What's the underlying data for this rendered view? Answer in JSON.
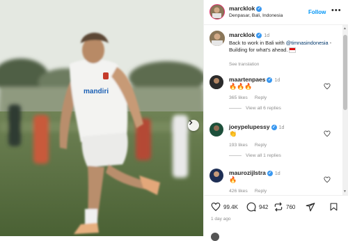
{
  "post": {
    "username": "marcklok",
    "location": "Denpasar, Bali, Indonesia",
    "follow_label": "Follow",
    "more_label": "•••",
    "verified_mark": "✓"
  },
  "caption": {
    "username": "marcklok",
    "time": "1d",
    "text_part1": "Back to work in Bali with ",
    "mention": "@timnasindonesia",
    "text_part2": " - Building for what's ahead.",
    "flag_icon": "indonesia-flag-icon",
    "see_translation": "See translation"
  },
  "comments": [
    {
      "username": "maartenpaes",
      "time": "1d",
      "emoji": "🔥🔥🔥",
      "likes": "365 likes",
      "reply": "Reply",
      "view_replies": "View all 6 replies",
      "avatar_color": "#2b2b2b"
    },
    {
      "username": "joeypelupessy",
      "time": "1d",
      "emoji": "👏",
      "likes": "193 likes",
      "reply": "Reply",
      "view_replies": "View all 1 replies",
      "avatar_color": "#1d4f3a"
    },
    {
      "username": "maurozijlstra",
      "time": "1d",
      "emoji": "🔥",
      "likes": "426 likes",
      "reply": "Reply",
      "view_replies": "",
      "avatar_color": "#1e2f55"
    }
  ],
  "actions": {
    "likes_count": "99.4K",
    "comments_count": "942",
    "reposts_count": "760",
    "time_ago": "1 day ago"
  },
  "media": {
    "jersey_text": "mandiri",
    "brand_color": "#1a5fb4"
  },
  "colors": {
    "accent": "#0095f6",
    "verified": "#3897f0",
    "muted": "#8e8e8e"
  }
}
